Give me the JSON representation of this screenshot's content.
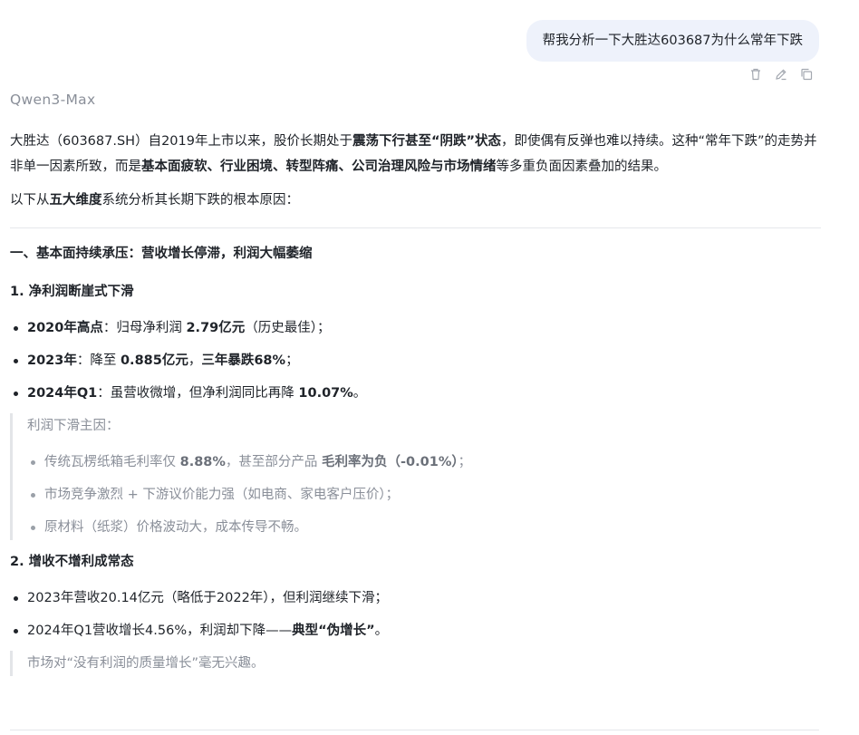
{
  "user_message": "帮我分析一下大胜达603687为什么常年下跌",
  "model_name": "Qwen3-Max",
  "intro": {
    "p1": [
      "大胜达（603687.SH）自2019年上市以来，股价长期处于",
      "震荡下行甚至“阴跌”状态",
      "，即使偶有反弹也难以持续。这种“常年下跌”的走势并非单一因素所致，而是",
      "基本面疲软、行业困境、转型阵痛、公司治理风险与市场情绪",
      "等多重负面因素叠加的结果。"
    ],
    "p2": [
      "以下从",
      "五大维度",
      "系统分析其长期下跌的根本原因："
    ]
  },
  "section1": {
    "title": "一、基本面持续承压：营收增长停滞，利润大幅萎缩",
    "sub1": {
      "title": "1. 净利润断崖式下滑",
      "items": [
        [
          "2020年高点",
          "：归母净利润 ",
          "2.79亿元",
          "（历史最佳）；"
        ],
        [
          "2023年",
          "：降至 ",
          "0.885亿元",
          "，",
          "三年暴跌68%",
          "；"
        ],
        [
          "2024年Q1",
          "：虽营收微增，但净利润同比再降 ",
          "10.07%",
          "。"
        ]
      ],
      "quote_title": "利润下滑主因：",
      "quote_items": [
        [
          "传统瓦楞纸箱毛利率仅 ",
          "8.88%",
          "，甚至部分产品 ",
          "毛利率为负（-0.01%）",
          "；"
        ],
        [
          "市场竞争激烈 + 下游议价能力强（如电商、家电客户压价）；"
        ],
        [
          "原材料（纸浆）价格波动大，成本传导不畅。"
        ]
      ]
    },
    "sub2": {
      "title": "2. 增收不增利成常态",
      "items": [
        [
          "2023年营收20.14亿元（略低于2022年），但利润继续下滑；"
        ],
        [
          "2024年Q1营收增长4.56%，利润却下降——",
          "典型“伪增长”",
          "。"
        ]
      ],
      "quote": "市场对“没有利润的质量增长”毫无兴趣。"
    }
  },
  "icons": [
    "trash-icon",
    "edit-icon",
    "copy-icon"
  ]
}
